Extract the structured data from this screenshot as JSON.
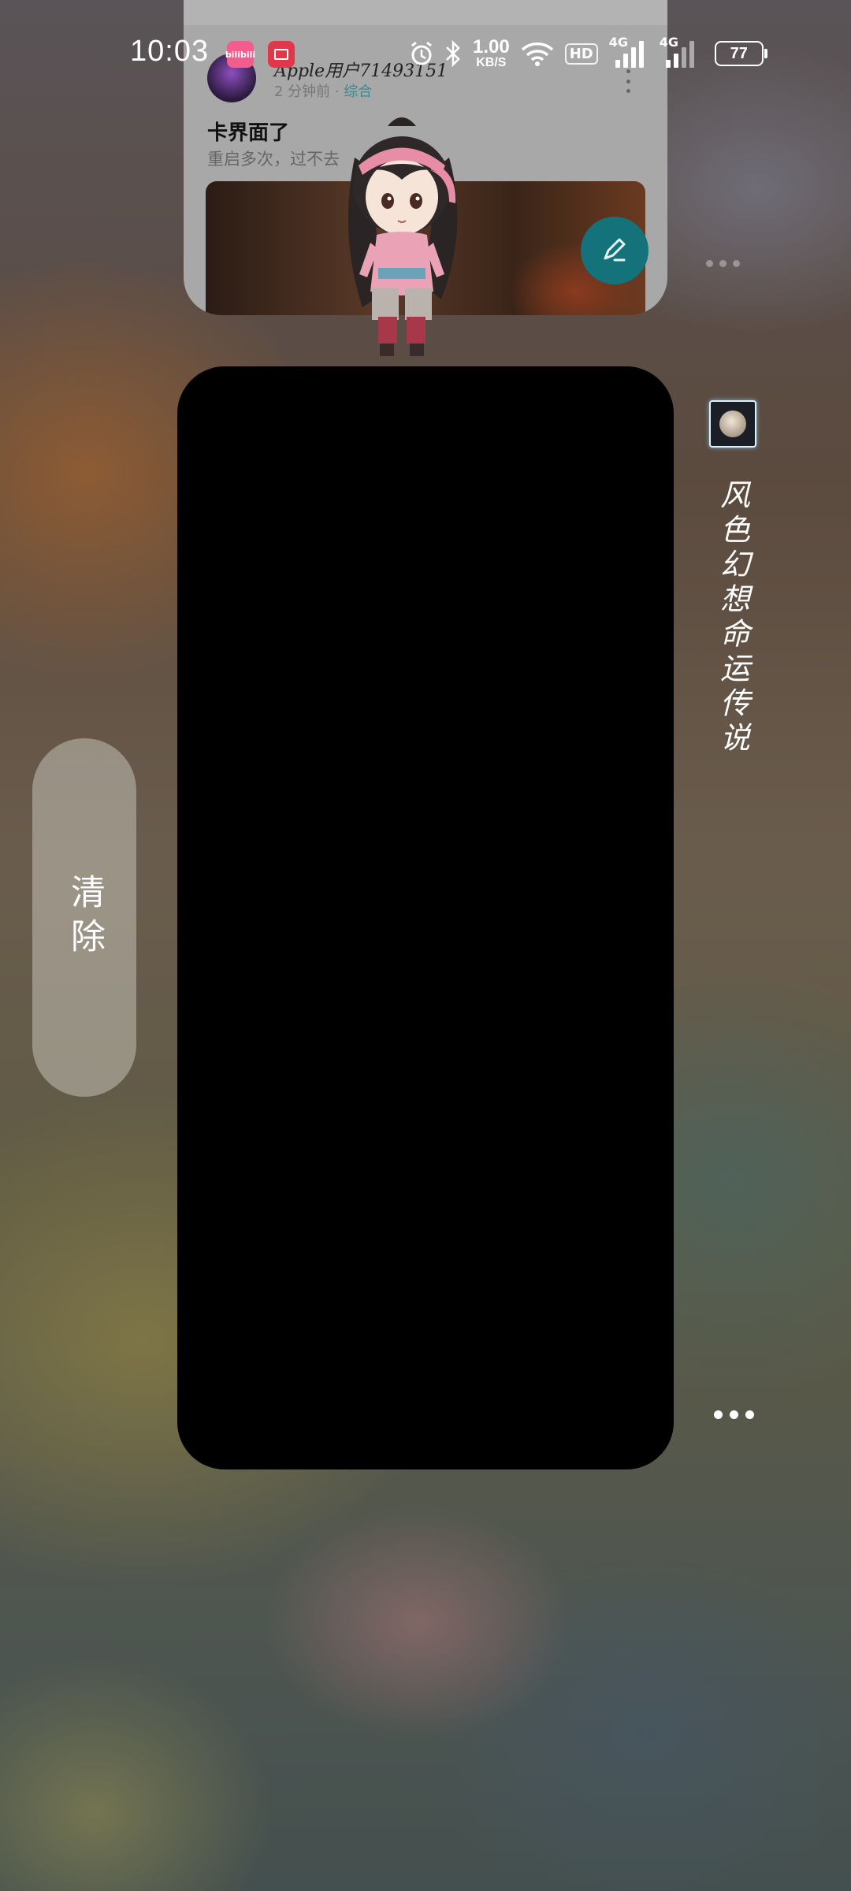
{
  "status_bar": {
    "time": "10:03",
    "app_badge": "bilibili",
    "net_speed_value": "1.00",
    "net_speed_unit": "KB/S",
    "hd_label": "HD",
    "signal1_label": "4G",
    "signal2_label": "4G",
    "battery_level": "77"
  },
  "recent_top_card": {
    "username": "Apple用户71493151",
    "time_ago": "2 分钟前",
    "separator": " · ",
    "category": "综合",
    "post_title": "卡界面了",
    "post_body": "重启多次，过不去"
  },
  "recent_main_card": {
    "app_name": "风色幻想命运传说"
  },
  "clear_button": {
    "label": "清除"
  },
  "colors": {
    "fab": "#14737a",
    "bilibili_pink": "#f25d8e"
  }
}
